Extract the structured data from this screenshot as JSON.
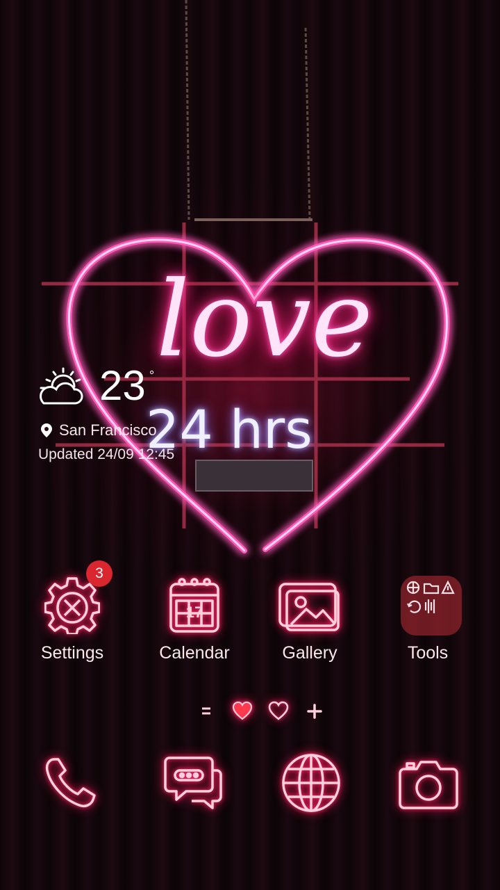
{
  "weather": {
    "temperature": "23",
    "unit": "°",
    "location": "San Francisco",
    "updated": "Updated 24/09 12:45",
    "icon": "partly-cloudy-icon"
  },
  "wallpaper": {
    "neon_text": [
      "love",
      "24 hrs"
    ],
    "colors": {
      "neon_pink": "#ff4fa8",
      "neon_white": "#ffe6ff",
      "glow": "#ff1f6e"
    }
  },
  "apps": [
    {
      "label": "Settings",
      "icon": "settings-gear-icon",
      "badge": "3"
    },
    {
      "label": "Calendar",
      "icon": "calendar-icon",
      "day": "17"
    },
    {
      "label": "Gallery",
      "icon": "gallery-icon"
    },
    {
      "label": "Tools",
      "icon": "folder-icon"
    }
  ],
  "page_indicator": {
    "items": [
      "menu-lines-icon",
      "heart-filled-icon",
      "heart-outline-icon",
      "plus-icon"
    ],
    "active_index": 1
  },
  "dock": [
    {
      "icon": "phone-icon"
    },
    {
      "icon": "messages-icon"
    },
    {
      "icon": "browser-globe-icon"
    },
    {
      "icon": "camera-icon"
    }
  ]
}
